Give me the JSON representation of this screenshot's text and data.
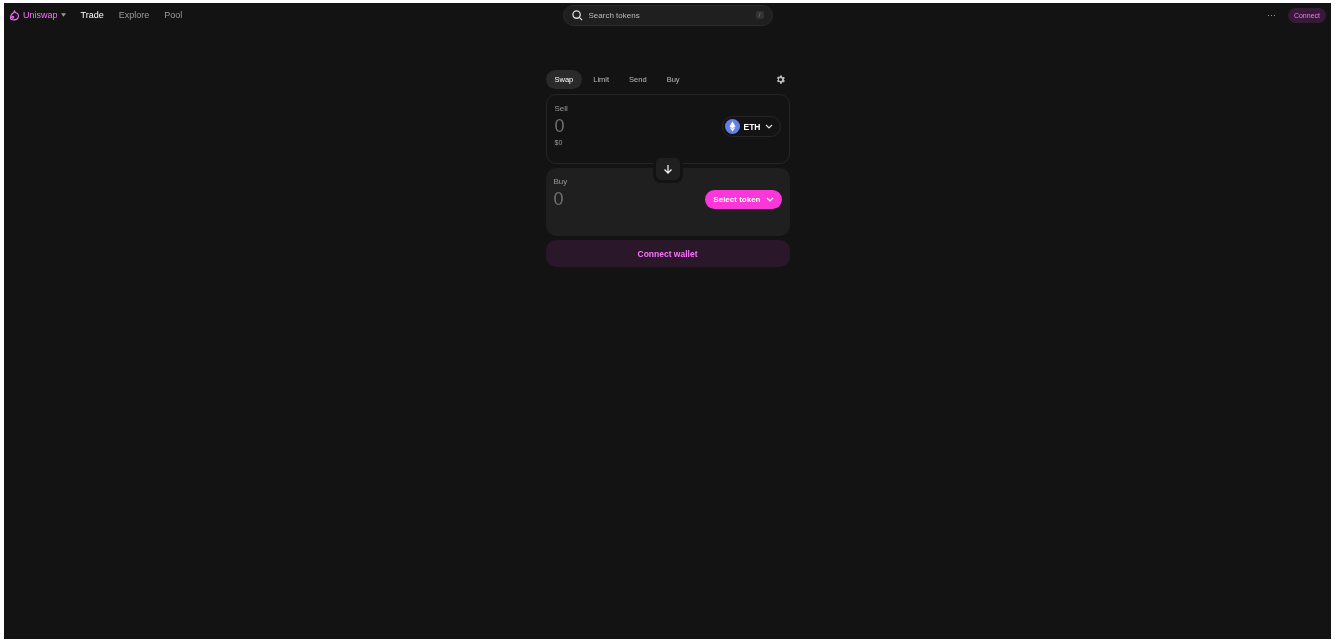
{
  "nav": {
    "brand": "Uniswap",
    "links": [
      {
        "label": "Trade",
        "selected": true
      },
      {
        "label": "Explore",
        "selected": false
      },
      {
        "label": "Pool",
        "selected": false
      }
    ],
    "search": {
      "placeholder": "Search tokens",
      "shortcut": "/"
    },
    "more": "···",
    "connect": "Connect"
  },
  "swap": {
    "tabs": [
      {
        "label": "Swap",
        "selected": true
      },
      {
        "label": "Limit",
        "selected": false
      },
      {
        "label": "Send",
        "selected": false
      },
      {
        "label": "Buy",
        "selected": false
      }
    ],
    "sell": {
      "label": "Sell",
      "amount": "0",
      "usd": "$0",
      "token": "ETH"
    },
    "buy": {
      "label": "Buy",
      "amount": "0",
      "select": "Select token"
    },
    "connect_wallet": "Connect wallet"
  }
}
